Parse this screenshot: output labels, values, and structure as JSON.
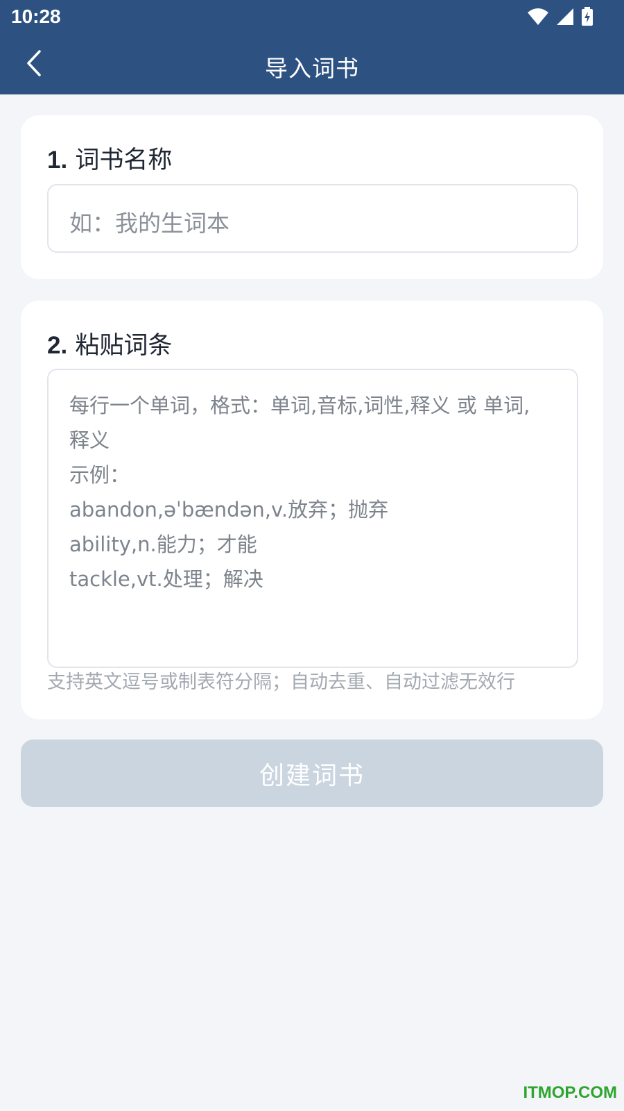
{
  "status_bar": {
    "time": "10:28",
    "icons": [
      "wifi-icon",
      "cellular-signal-icon",
      "battery-charging-icon"
    ]
  },
  "app_bar": {
    "back_icon": "chevron-left-icon",
    "title": "导入词书"
  },
  "section1": {
    "number": "1.",
    "title": "词书名称",
    "input_placeholder": "如：我的生词本",
    "input_value": ""
  },
  "section2": {
    "number": "2.",
    "title": "粘贴词条",
    "textarea_placeholder_lines": [
      "每行一个单词，格式：单词,音标,词性,释义 或 单词,",
      "释义",
      "示例：",
      "abandon,əˈbændən,v.放弃；抛弃",
      "ability,n.能力；才能",
      "tackle,vt.处理；解决"
    ],
    "hint": "支持英文逗号或制表符分隔；自动去重、自动过滤无效行"
  },
  "create_button": {
    "label": "创建词书",
    "enabled": false
  },
  "watermark": "ITMOP.COM",
  "colors": {
    "primary": "#2d5282",
    "background": "#f3f5f8",
    "card": "#ffffff",
    "button_disabled": "#cad5e0",
    "watermark": "#2ea52e"
  }
}
